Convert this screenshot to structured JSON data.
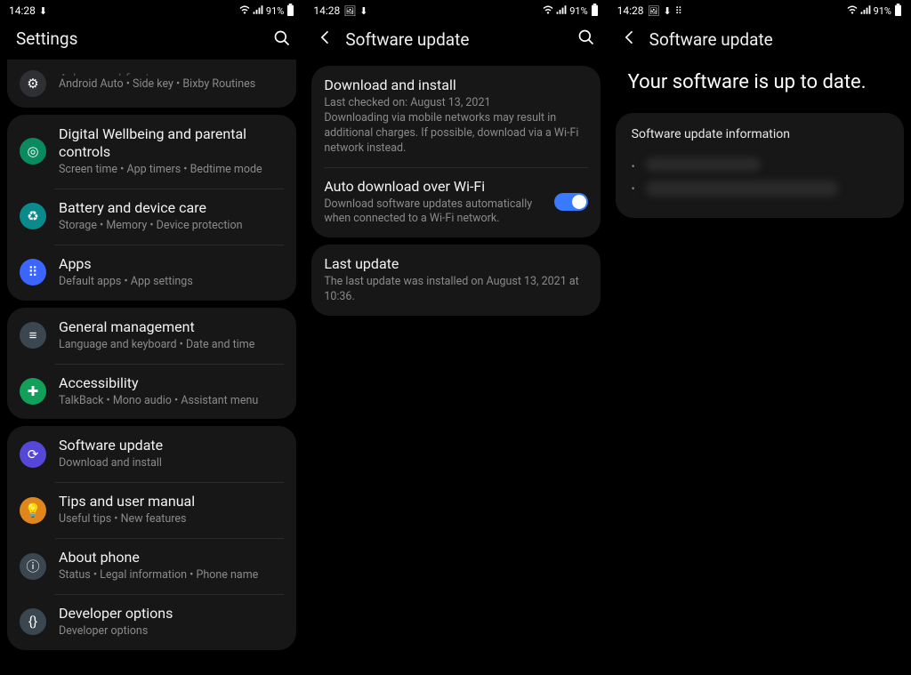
{
  "status": {
    "time": "14:28",
    "battery_text": "91%",
    "icons_left": "⬇",
    "icons_mid": "🖼",
    "icons_grid": "⠿"
  },
  "p1": {
    "title": "Settings",
    "groups": [
      {
        "partial_top": true,
        "items": [
          {
            "title": "Advanced features",
            "sub": "Android Auto  •  Side key  •  Bixby Routines",
            "icon_bg": "#2f3033",
            "icon_glyph": "⚙",
            "dim_top": true
          }
        ]
      },
      {
        "items": [
          {
            "title": "Digital Wellbeing and parental controls",
            "sub": "Screen time  •  App timers  •  Bedtime mode",
            "icon_bg": "#0a8a5f",
            "icon_glyph": "◎"
          },
          {
            "title": "Battery and device care",
            "sub": "Storage  •  Memory  •  Device protection",
            "icon_bg": "#0a8a8a",
            "icon_glyph": "♻"
          },
          {
            "title": "Apps",
            "sub": "Default apps  •  App settings",
            "icon_bg": "#3a66ff",
            "icon_glyph": "⠿"
          }
        ]
      },
      {
        "items": [
          {
            "title": "General management",
            "sub": "Language and keyboard  •  Date and time",
            "icon_bg": "#3a4750",
            "icon_glyph": "≡"
          },
          {
            "title": "Accessibility",
            "sub": "TalkBack  •  Mono audio  •  Assistant menu",
            "icon_bg": "#11a05a",
            "icon_glyph": "✚"
          }
        ]
      },
      {
        "items": [
          {
            "title": "Software update",
            "sub": "Download and install",
            "icon_bg": "#5547d7",
            "icon_glyph": "⟳"
          },
          {
            "title": "Tips and user manual",
            "sub": "Useful tips  •  New features",
            "icon_bg": "#e0861a",
            "icon_glyph": "💡"
          },
          {
            "title": "About phone",
            "sub": "Status  •  Legal information  •  Phone name",
            "icon_bg": "#3a4750",
            "icon_glyph": "ⓘ"
          },
          {
            "title": "Developer options",
            "sub": "Developer options",
            "icon_bg": "#3a4750",
            "icon_glyph": "{}"
          }
        ]
      }
    ]
  },
  "p2": {
    "title": "Software update",
    "card1": [
      {
        "title": "Download and install",
        "sub": "Last checked on: August 13, 2021\nDownloading via mobile networks may result in additional charges. If possible, download via a Wi-Fi network instead."
      },
      {
        "title": "Auto download over Wi-Fi",
        "sub": "Download software updates automatically when connected to a Wi-Fi network.",
        "toggle": true
      }
    ],
    "card2": [
      {
        "title": "Last update",
        "sub": "The last update was installed on August 13, 2021 at 10:36."
      }
    ]
  },
  "p3": {
    "title": "Software update",
    "uptodate": "Your software is up to date.",
    "info_header": "Software update information"
  }
}
